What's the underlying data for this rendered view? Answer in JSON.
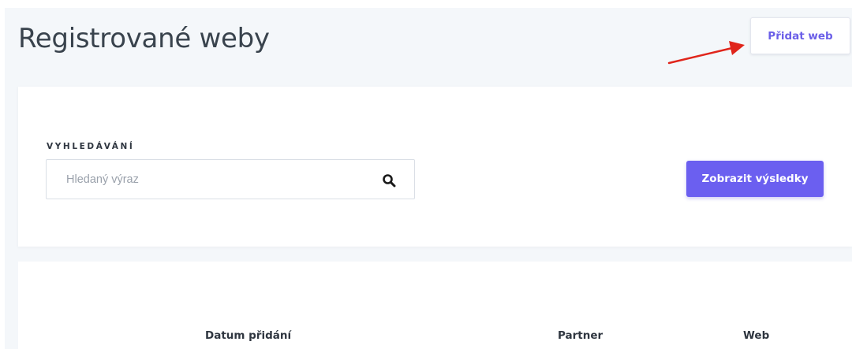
{
  "header": {
    "title": "Registrované weby",
    "add_button_label": "Přidat web"
  },
  "search": {
    "section_label": "VYHLEDÁVÁNÍ",
    "input_value": "",
    "placeholder": "Hledaný výraz",
    "search_icon": "search-icon",
    "submit_label": "Zobrazit výsledky"
  },
  "table": {
    "columns": [
      "Datum přidání",
      "Partner",
      "Web"
    ]
  },
  "annotation": {
    "icon": "arrow-pointer-icon",
    "color": "#e0251b"
  },
  "colors": {
    "accent": "#6b5ff0",
    "page_background": "#f4f7fa",
    "title_text": "#39434d"
  }
}
